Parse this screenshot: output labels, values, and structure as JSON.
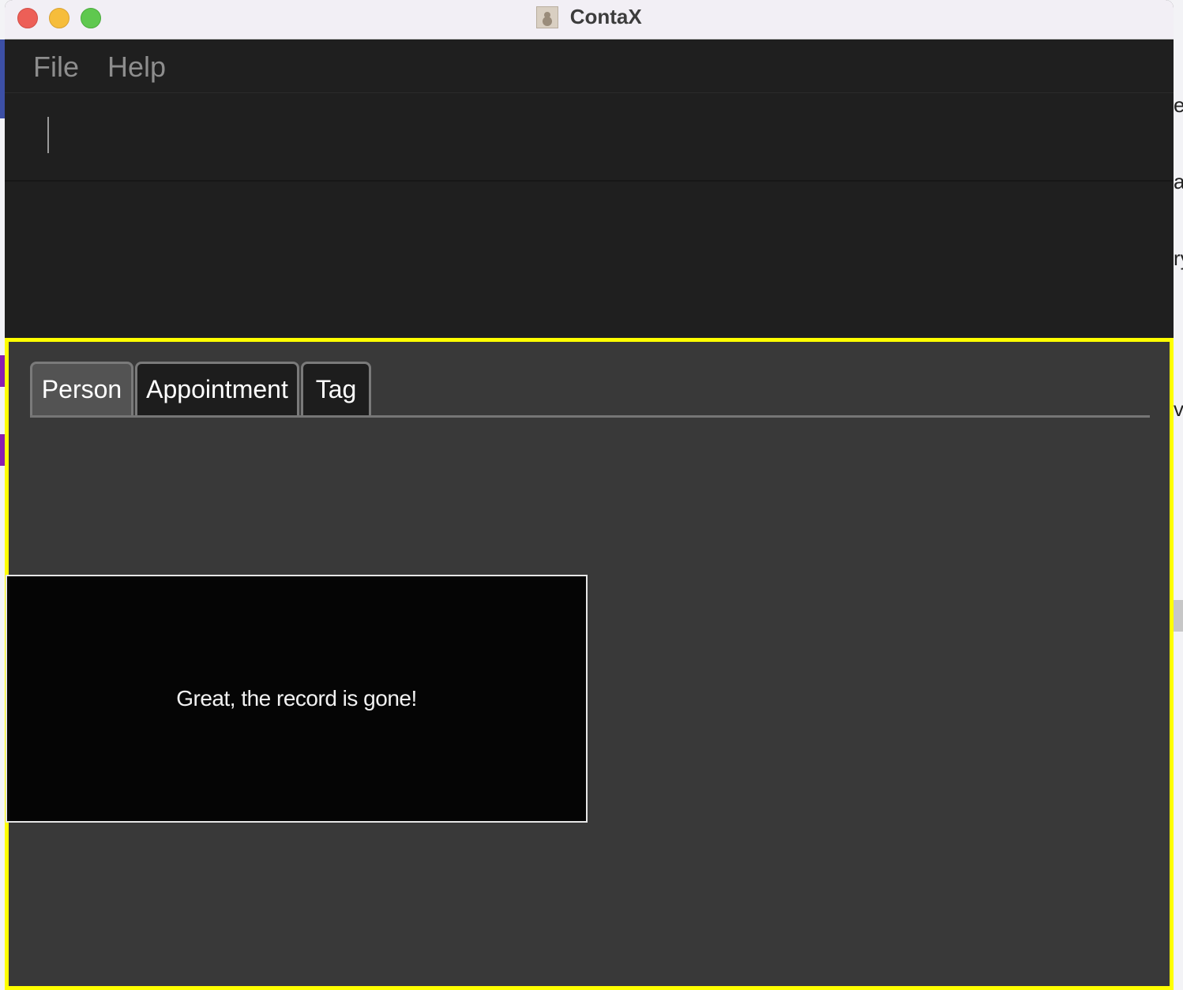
{
  "window": {
    "title": "ContaX"
  },
  "menu": {
    "items": [
      "File",
      "Help"
    ]
  },
  "command_box": {
    "value": ""
  },
  "tabs": [
    {
      "label": "Person",
      "active": true
    },
    {
      "label": "Appointment",
      "active": false
    },
    {
      "label": "Tag",
      "active": false
    }
  ],
  "toast": {
    "message": "Great, the record is gone!"
  },
  "background_fragments": [
    "e)",
    "a",
    "ry",
    "va"
  ],
  "colors": {
    "highlight_border": "#ffff00",
    "panel_background": "#393939",
    "window_background": "#1f1f1f"
  }
}
